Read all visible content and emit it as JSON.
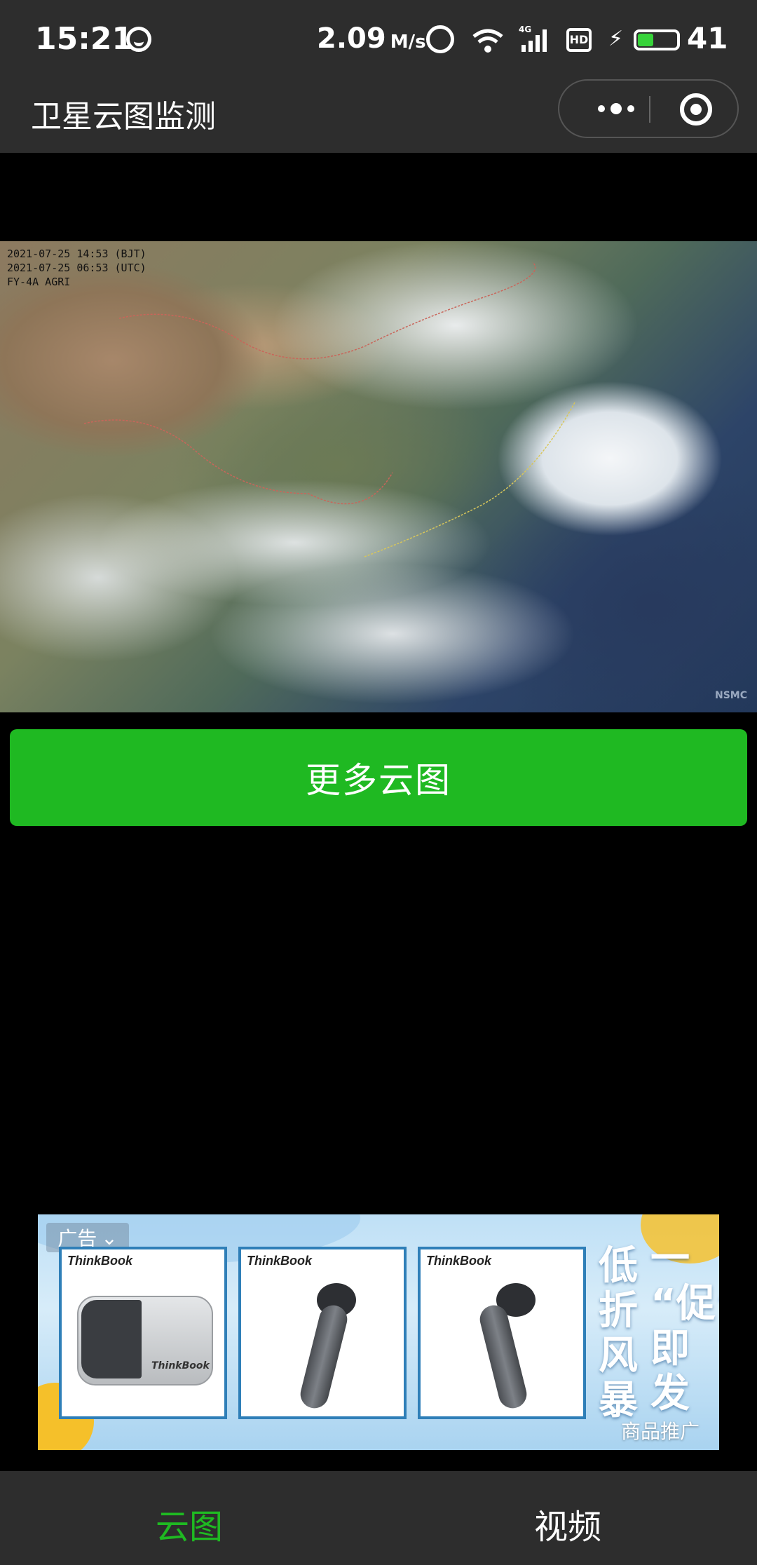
{
  "status_bar": {
    "time": "15:21",
    "speed": "2.09",
    "speed_unit": "M/s",
    "network": "4G",
    "hd_label": "HD",
    "battery_level": "41",
    "battery_fraction": 0.41,
    "accent": "#37d33a"
  },
  "nav": {
    "title": "卫星云图监测",
    "more_icon": "more-dots-icon",
    "close_icon": "target-circle-icon"
  },
  "satellite": {
    "caption_line1": "2021-07-25 14:53 (BJT)",
    "caption_line2": "2021-07-25 06:53 (UTC)",
    "caption_line3": "FY-4A AGRI",
    "logo": "NSMC"
  },
  "more_button": {
    "label": "更多云图",
    "color": "#1fb922"
  },
  "ad": {
    "tag": "广告",
    "products": [
      {
        "brand": "ThinkBook",
        "case_text": "ThinkBook"
      },
      {
        "brand": "ThinkBook"
      },
      {
        "brand": "ThinkBook"
      }
    ],
    "promo_left": [
      "低",
      "折",
      "风",
      "暴"
    ],
    "promo_right": [
      "一",
      "“促”",
      "即",
      "发"
    ],
    "footer": "商品推广"
  },
  "tabs": [
    {
      "label": "云图",
      "active": true
    },
    {
      "label": "视频",
      "active": false
    }
  ],
  "colors": {
    "bar_bg": "#2d2d2d",
    "tab_active": "#1fb922"
  }
}
